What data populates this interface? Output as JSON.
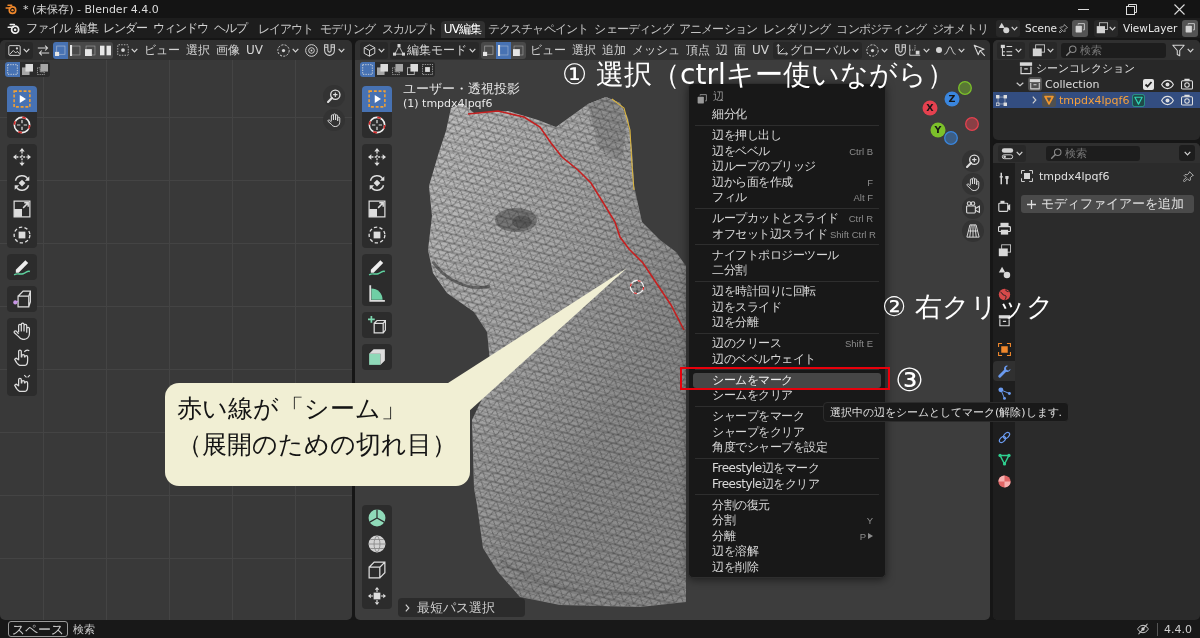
{
  "window": {
    "title": "* (未保存) - Blender 4.4.0"
  },
  "top_bar": {
    "menus": [
      "ファイル",
      "編集",
      "レンダー",
      "ウィンドウ",
      "ヘルプ"
    ],
    "workspaces": [
      {
        "label": "レイアウト",
        "selected": false
      },
      {
        "label": "モデリング",
        "selected": false
      },
      {
        "label": "スカルプト",
        "selected": false
      },
      {
        "label": "UV編集",
        "selected": true
      },
      {
        "label": "テクスチャペイント",
        "selected": false
      },
      {
        "label": "シェーディング",
        "selected": false
      },
      {
        "label": "アニメーション",
        "selected": false
      },
      {
        "label": "レンダリング",
        "selected": false
      },
      {
        "label": "コンポジティング",
        "selected": false
      },
      {
        "label": "ジオメトリ",
        "selected": false
      }
    ],
    "scene": "Scene",
    "view_layer": "ViewLayer"
  },
  "uv_editor": {
    "select_modes": [
      {
        "kind": "vertex",
        "selected": true
      },
      {
        "kind": "edge",
        "selected": false
      },
      {
        "kind": "face",
        "selected": false
      },
      {
        "kind": "island",
        "selected": false
      }
    ],
    "menus": [
      "ビュー",
      "選択",
      "画像",
      "UV"
    ],
    "box_modes": [
      {
        "kind": "new",
        "selected": true
      },
      {
        "kind": "extend",
        "selected": false
      },
      {
        "kind": "subtract",
        "selected": false
      }
    ],
    "tools": [
      [
        {
          "kind": "select-box",
          "selected": true
        },
        {
          "kind": "cursor",
          "selected": false
        }
      ],
      [
        {
          "kind": "move",
          "selected": false
        },
        {
          "kind": "rotate",
          "selected": false
        },
        {
          "kind": "scale",
          "selected": false
        },
        {
          "kind": "transform",
          "selected": false
        }
      ],
      [
        {
          "kind": "annotate",
          "selected": false
        }
      ],
      [
        {
          "kind": "rip",
          "selected": false
        }
      ],
      [
        {
          "kind": "grab",
          "selected": false
        },
        {
          "kind": "relax",
          "selected": false
        },
        {
          "kind": "pinch",
          "selected": false
        }
      ]
    ]
  },
  "viewport": {
    "mode": "編集モード",
    "select_modes": [
      {
        "kind": "vertex",
        "selected": false
      },
      {
        "kind": "edge",
        "selected": true
      },
      {
        "kind": "face",
        "selected": false
      }
    ],
    "menus": [
      "ビュー",
      "選択",
      "追加",
      "メッシュ",
      "頂点",
      "辺",
      "面",
      "UV"
    ],
    "orientation": "グローバル",
    "box_modes": [
      {
        "kind": "new",
        "selected": true
      },
      {
        "kind": "extend",
        "selected": false
      },
      {
        "kind": "subtract",
        "selected": false
      },
      {
        "kind": "invert",
        "selected": false
      },
      {
        "kind": "intersect",
        "selected": false
      }
    ],
    "view_name": "ユーザー・透視投影",
    "object_name": "(1) tmpdx4lpqf6",
    "tools": [
      [
        {
          "kind": "select-box",
          "selected": true
        },
        {
          "kind": "cursor",
          "selected": false
        }
      ],
      [
        {
          "kind": "move",
          "selected": false
        },
        {
          "kind": "rotate",
          "selected": false
        },
        {
          "kind": "scale",
          "selected": false
        },
        {
          "kind": "transform",
          "selected": false
        }
      ],
      [
        {
          "kind": "annotate",
          "selected": false
        },
        {
          "kind": "measure",
          "selected": false
        }
      ],
      [
        {
          "kind": "add-cube",
          "selected": false
        }
      ],
      [
        {
          "kind": "extrude",
          "selected": false
        }
      ],
      [
        {
          "kind": "spin",
          "selected": false
        },
        {
          "kind": "smooth",
          "selected": false
        },
        {
          "kind": "edge-slide",
          "selected": false
        },
        {
          "kind": "shrink-fatten",
          "selected": false
        }
      ]
    ],
    "axes": [
      {
        "label": "X",
        "color": "#e5414f"
      },
      {
        "label": "Y",
        "color": "#7cc12a"
      },
      {
        "label": "Z",
        "color": "#3a86de"
      }
    ],
    "last_operator": "最短パス選択"
  },
  "context_menu": {
    "title": "辺",
    "groups": [
      [
        {
          "label": "細分化",
          "selected": false,
          "submenu": false
        }
      ],
      [
        {
          "label": "辺を押し出し",
          "selected": false,
          "submenu": false
        },
        {
          "label": "辺をベベル",
          "shortcut": "Ctrl B",
          "selected": false,
          "submenu": false
        },
        {
          "label": "辺ループのブリッジ",
          "selected": false,
          "submenu": false
        },
        {
          "label": "辺から面を作成",
          "shortcut": "F",
          "selected": false,
          "submenu": false
        },
        {
          "label": "フィル",
          "shortcut": "Alt F",
          "selected": false,
          "submenu": false
        }
      ],
      [
        {
          "label": "ループカットとスライド",
          "shortcut": "Ctrl R",
          "selected": false,
          "submenu": false
        },
        {
          "label": "オフセット辺スライド",
          "shortcut": "Shift Ctrl R",
          "selected": false,
          "submenu": false
        }
      ],
      [
        {
          "label": "ナイフトポロジーツール",
          "selected": false,
          "submenu": false
        },
        {
          "label": "二分割",
          "selected": false,
          "submenu": false
        }
      ],
      [
        {
          "label": "辺を時計回りに回転",
          "selected": false,
          "submenu": false
        },
        {
          "label": "辺をスライド",
          "selected": false,
          "submenu": false
        },
        {
          "label": "辺を分離",
          "selected": false,
          "submenu": false
        }
      ],
      [
        {
          "label": "辺のクリース",
          "shortcut": "Shift E",
          "selected": false,
          "submenu": false
        },
        {
          "label": "辺のベベルウェイト",
          "selected": false,
          "submenu": false
        }
      ],
      [
        {
          "label": "シームをマーク",
          "selected": true,
          "submenu": false
        },
        {
          "label": "シームをクリア",
          "selected": false,
          "submenu": false
        }
      ],
      [
        {
          "label": "シャープをマーク",
          "selected": false,
          "submenu": false
        },
        {
          "label": "シャープをクリア",
          "selected": false,
          "submenu": false
        },
        {
          "label": "角度でシャープを設定",
          "selected": false,
          "submenu": false
        }
      ],
      [
        {
          "label": "Freestyle辺をマーク",
          "selected": false,
          "submenu": false
        },
        {
          "label": "Freestyle辺をクリア",
          "selected": false,
          "submenu": false
        }
      ],
      [
        {
          "label": "分割の復元",
          "selected": false,
          "submenu": false
        },
        {
          "label": "分割",
          "shortcut": "Y",
          "selected": false,
          "submenu": false
        },
        {
          "label": "分離",
          "shortcut": "P",
          "selected": false,
          "submenu": true
        },
        {
          "label": "辺を溶解",
          "selected": false,
          "submenu": false
        },
        {
          "label": "辺を削除",
          "selected": false,
          "submenu": false
        }
      ]
    ]
  },
  "tooltip": "選択中の辺をシームとしてマーク(解除)します.",
  "outliner": {
    "search_placeholder": "検索",
    "tree": [
      {
        "kind": "scene-collection",
        "label": "シーンコレクション",
        "selected": false,
        "children": [
          {
            "kind": "collection",
            "label": "Collection",
            "expanded": true,
            "checked": true,
            "selected": false,
            "children": [
              {
                "kind": "mesh-object",
                "label": "tmpdx4lpqf6",
                "expanded": false,
                "edit_mode": true,
                "selected": true
              }
            ]
          }
        ]
      }
    ]
  },
  "properties": {
    "search_placeholder": "検索",
    "tabs": [
      [
        {
          "kind": "tool",
          "selected": false
        }
      ],
      [
        {
          "kind": "render",
          "selected": false
        },
        {
          "kind": "output",
          "selected": false
        },
        {
          "kind": "view-layer",
          "selected": false
        },
        {
          "kind": "scene",
          "selected": false
        },
        {
          "kind": "world",
          "selected": false
        }
      ],
      [
        {
          "kind": "collection",
          "selected": false
        }
      ],
      [
        {
          "kind": "object",
          "selected": false
        },
        {
          "kind": "modifiers",
          "selected": true
        },
        {
          "kind": "particles",
          "selected": false
        }
      ],
      [
        {
          "kind": "constraints",
          "selected": false
        },
        {
          "kind": "data",
          "selected": false
        },
        {
          "kind": "material",
          "selected": false
        }
      ]
    ],
    "object_name": "tmpdx4lpqf6",
    "add_modifier": "モディファイアーを追加"
  },
  "annotations": {
    "step_1": "① 選択（ctrlキー使いながら）",
    "step_2": "② 右クリック",
    "step_3": "③",
    "callout": [
      "赤い線が「シーム」",
      "（展開のための切れ目）"
    ]
  },
  "status_bar": {
    "key": "スペース",
    "action": "検索",
    "version": "4.4.0"
  }
}
